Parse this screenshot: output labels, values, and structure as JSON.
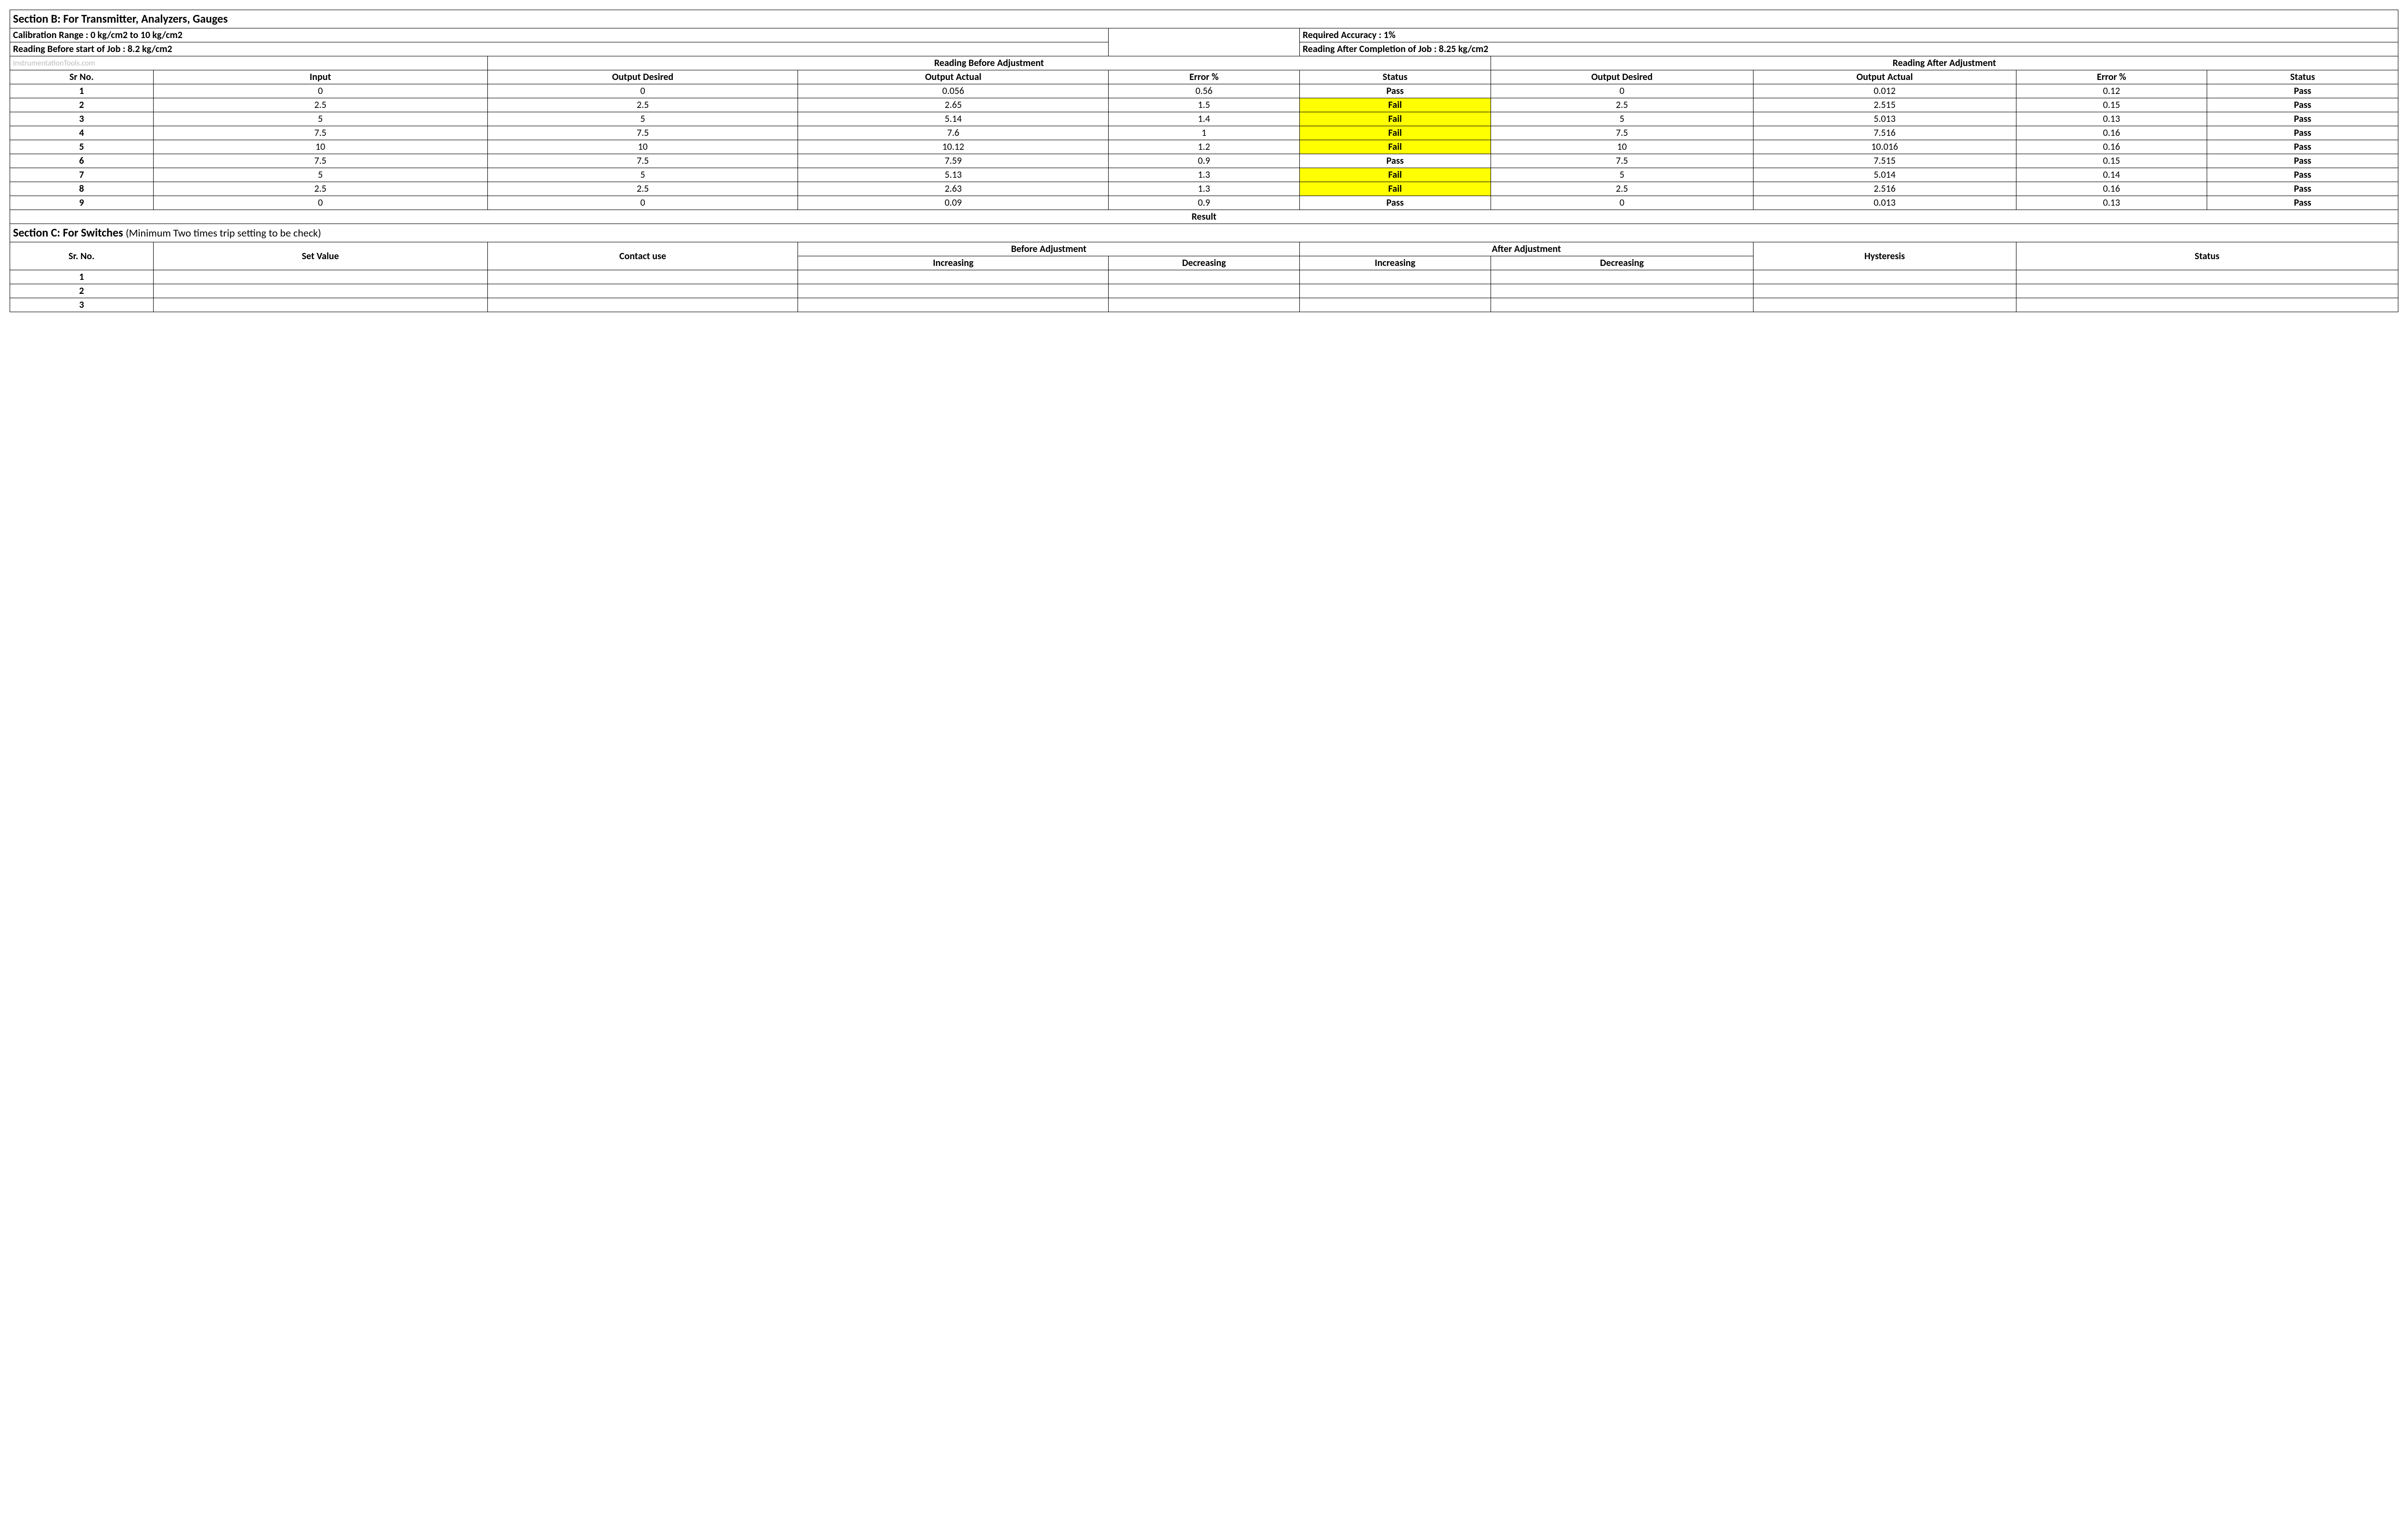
{
  "sectionB": {
    "title": "Section B:  For Transmitter, Analyzers, Gauges",
    "calibrationRange": "Calibration Range : 0 kg/cm2 to 10 kg/cm2",
    "requiredAccuracy": "Required Accuracy : 1%",
    "readingBefore": "Reading Before start of Job : 8.2 kg/cm2",
    "readingAfter": "Reading After Completion of Job : 8.25 kg/cm2",
    "watermark": "InstrumentationTools.com",
    "beforeAdjLabel": "Reading Before Adjustment",
    "afterAdjLabel": "Reading After Adjustment",
    "cols": {
      "srno": "Sr No.",
      "input": "Input",
      "outDesired": "Output Desired",
      "outActual": "Output Actual",
      "error": "Error %",
      "status": "Status"
    },
    "rows": [
      {
        "sr": "1",
        "in": "0",
        "bd": "0",
        "ba": "0.056",
        "be": "0.56",
        "bs": "Pass",
        "ad": "0",
        "aa": "0.012",
        "ae": "0.12",
        "as": "Pass"
      },
      {
        "sr": "2",
        "in": "2.5",
        "bd": "2.5",
        "ba": "2.65",
        "be": "1.5",
        "bs": "Fail",
        "ad": "2.5",
        "aa": "2.515",
        "ae": "0.15",
        "as": "Pass"
      },
      {
        "sr": "3",
        "in": "5",
        "bd": "5",
        "ba": "5.14",
        "be": "1.4",
        "bs": "Fail",
        "ad": "5",
        "aa": "5.013",
        "ae": "0.13",
        "as": "Pass"
      },
      {
        "sr": "4",
        "in": "7.5",
        "bd": "7.5",
        "ba": "7.6",
        "be": "1",
        "bs": "Fail",
        "ad": "7.5",
        "aa": "7.516",
        "ae": "0.16",
        "as": "Pass"
      },
      {
        "sr": "5",
        "in": "10",
        "bd": "10",
        "ba": "10.12",
        "be": "1.2",
        "bs": "Fail",
        "ad": "10",
        "aa": "10.016",
        "ae": "0.16",
        "as": "Pass"
      },
      {
        "sr": "6",
        "in": "7.5",
        "bd": "7.5",
        "ba": "7.59",
        "be": "0.9",
        "bs": "Pass",
        "ad": "7.5",
        "aa": "7.515",
        "ae": "0.15",
        "as": "Pass"
      },
      {
        "sr": "7",
        "in": "5",
        "bd": "5",
        "ba": "5.13",
        "be": "1.3",
        "bs": "Fail",
        "ad": "5",
        "aa": "5.014",
        "ae": "0.14",
        "as": "Pass"
      },
      {
        "sr": "8",
        "in": "2.5",
        "bd": "2.5",
        "ba": "2.63",
        "be": "1.3",
        "bs": "Fail",
        "ad": "2.5",
        "aa": "2.516",
        "ae": "0.16",
        "as": "Pass"
      },
      {
        "sr": "9",
        "in": "0",
        "bd": "0",
        "ba": "0.09",
        "be": "0.9",
        "bs": "Pass",
        "ad": "0",
        "aa": "0.013",
        "ae": "0.13",
        "as": "Pass"
      }
    ],
    "resultLabel": "Result"
  },
  "sectionC": {
    "title": "Section C:  For Switches",
    "note": "(Minimum Two times trip setting to be check)",
    "cols": {
      "srno": "Sr. No.",
      "setValue": "Set Value",
      "contactUse": "Contact use",
      "beforeAdj": "Before Adjustment",
      "afterAdj": "After Adjustment",
      "increasing": "Increasing",
      "decreasing": "Decreasing",
      "hysteresis": "Hysteresis",
      "status": "Status"
    },
    "rows": [
      {
        "sr": "1"
      },
      {
        "sr": "2"
      },
      {
        "sr": "3"
      }
    ]
  }
}
